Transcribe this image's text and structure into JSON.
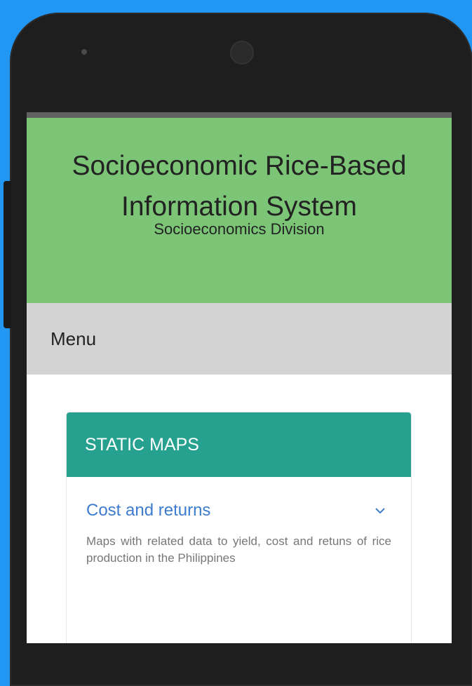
{
  "header": {
    "title": "Socioeconomic Rice-Based Information System",
    "subtitle": "Socioeconomics Division",
    "background": "#7cc576"
  },
  "menu": {
    "label": "Menu"
  },
  "card": {
    "heading": "STATIC MAPS",
    "accent": "#26a18f",
    "items": [
      {
        "title": "Cost and returns",
        "icon": "chevron-down-icon",
        "description": "Maps with related data to yield, cost and retuns of rice production in the Philippines"
      }
    ]
  }
}
